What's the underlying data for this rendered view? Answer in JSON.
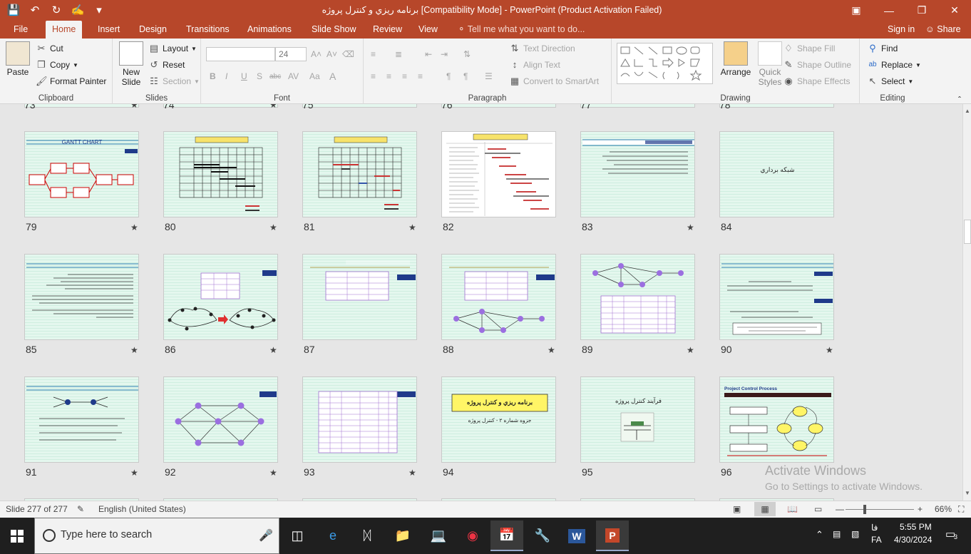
{
  "titlebar": {
    "title": "برنامه ريزي و كنترل پروژه [Compatibility Mode] - PowerPoint (Product Activation Failed)"
  },
  "tabs": {
    "file": "File",
    "home": "Home",
    "insert": "Insert",
    "design": "Design",
    "transitions": "Transitions",
    "animations": "Animations",
    "slideshow": "Slide Show",
    "review": "Review",
    "view": "View",
    "tell": "Tell me what you want to do...",
    "signin": "Sign in",
    "share": "Share"
  },
  "ribbon": {
    "clipboard": {
      "label": "Clipboard",
      "paste": "Paste",
      "cut": "Cut",
      "copy": "Copy",
      "format_painter": "Format Painter"
    },
    "slides": {
      "label": "Slides",
      "new_slide_1": "New",
      "new_slide_2": "Slide",
      "layout": "Layout",
      "reset": "Reset",
      "section": "Section"
    },
    "font": {
      "label": "Font",
      "font_size": "24",
      "bold": "B",
      "italic": "I",
      "underline": "U",
      "shadow": "S",
      "strike": "abc"
    },
    "paragraph": {
      "label": "Paragraph",
      "text_direction": "Text Direction",
      "align_text": "Align Text",
      "convert_smartart": "Convert to SmartArt"
    },
    "drawing": {
      "label": "Drawing",
      "arrange": "Arrange",
      "quick_styles_1": "Quick",
      "quick_styles_2": "Styles",
      "shape_fill": "Shape Fill",
      "shape_outline": "Shape Outline",
      "shape_effects": "Shape Effects"
    },
    "editing": {
      "label": "Editing",
      "find": "Find",
      "replace": "Replace",
      "select": "Select"
    }
  },
  "sorter": {
    "top_partial_numbers": [
      "73",
      "74",
      "75",
      "76",
      "77",
      "78"
    ],
    "slides": [
      {
        "num": "79",
        "star": true,
        "text": "GANTT CHART"
      },
      {
        "num": "80",
        "star": true,
        "text": ""
      },
      {
        "num": "81",
        "star": true,
        "text": ""
      },
      {
        "num": "82",
        "star": false,
        "text": ""
      },
      {
        "num": "83",
        "star": true,
        "text": ""
      },
      {
        "num": "84",
        "star": false,
        "text": "شبكه برداري"
      },
      {
        "num": "85",
        "star": true,
        "text": ""
      },
      {
        "num": "86",
        "star": true,
        "text": ""
      },
      {
        "num": "87",
        "star": false,
        "text": ""
      },
      {
        "num": "88",
        "star": true,
        "text": ""
      },
      {
        "num": "89",
        "star": true,
        "text": ""
      },
      {
        "num": "90",
        "star": true,
        "text": ""
      },
      {
        "num": "91",
        "star": true,
        "text": ""
      },
      {
        "num": "92",
        "star": true,
        "text": ""
      },
      {
        "num": "93",
        "star": true,
        "text": ""
      },
      {
        "num": "94",
        "star": false,
        "text": "برنامه ريزي و كنترل پروژه"
      },
      {
        "num": "95",
        "star": false,
        "text": "فرآيند كنترل پروژه"
      },
      {
        "num": "96",
        "star": false,
        "text": "Project Control Process"
      }
    ],
    "slide94_sub": "جزوه شماره ۲ - كنترل پروژه",
    "star_char": "★"
  },
  "watermark": {
    "line1": "Activate Windows",
    "line2": "Go to Settings to activate Windows."
  },
  "statusbar": {
    "slide_info": "Slide 277 of 277",
    "language": "English (United States)",
    "zoom": "66%"
  },
  "taskbar": {
    "search_placeholder": "Type here to search",
    "time": "5:55 PM",
    "date": "4/30/2024",
    "lang1": "فا",
    "lang2": "FA",
    "notif_count": "3"
  },
  "colors": {
    "accent": "#b7472a",
    "thumb_bg": "#e4f7ee",
    "node_purple": "#9b6fe0"
  }
}
